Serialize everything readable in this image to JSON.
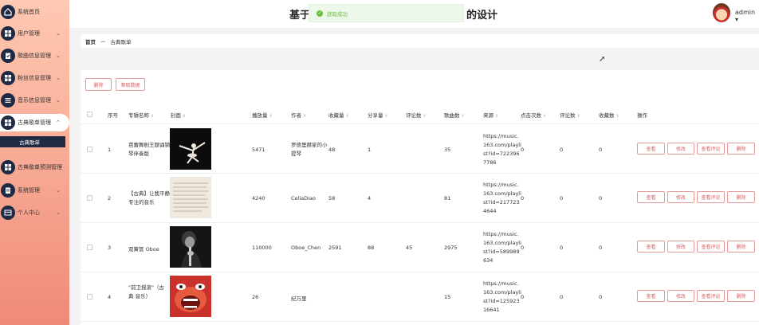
{
  "sidebar": {
    "items": [
      {
        "label": "系统首页",
        "icon": "home-icon"
      },
      {
        "label": "用户管理",
        "icon": "grid-icon",
        "arrow": "⌄"
      },
      {
        "label": "歌曲信息管理",
        "icon": "clipboard-icon",
        "arrow": "⌄"
      },
      {
        "label": "粉丝信息管理",
        "icon": "grid-icon",
        "arrow": "⌄"
      },
      {
        "label": "音乐信息管理",
        "icon": "list-icon",
        "arrow": "⌄"
      },
      {
        "label": "古典歌单管理",
        "icon": "grid-icon",
        "arrow": "⌃"
      },
      {
        "label": "古典歌单预测管理",
        "icon": "grid-icon"
      },
      {
        "label": "系统管理",
        "icon": "doc-icon",
        "arrow": "⌄"
      },
      {
        "label": "个人中心",
        "icon": "card-icon",
        "arrow": "⌄"
      }
    ],
    "sub_item": "古典歌单"
  },
  "header": {
    "title_left": "基于",
    "title_right": "的设计",
    "toast": "获取成功",
    "user": "admin ▾"
  },
  "breadcrumb": {
    "home": "首页",
    "sep": "—",
    "current": "古典歌单"
  },
  "toolbar": {
    "delete_label": "删除",
    "fetch_label": "爬取数据"
  },
  "table": {
    "headers": {
      "index": "序号",
      "album": "专辑名称",
      "cover": "封面",
      "plays": "播放量",
      "author": "作者",
      "collects": "收藏量",
      "shares": "分享量",
      "comments": "评论数",
      "songs": "歌曲数",
      "source": "来源",
      "clicks": "点击次数",
      "review_count": "评论数",
      "store_count": "收藏数",
      "ops": "操作"
    },
    "sort_glyph": "⇕",
    "rows": [
      {
        "index": "1",
        "album": "芭蕾舞剧王题诵钢琴伴奏版",
        "plays": "5471",
        "author": "罗德里赫家的小提琴",
        "collects": "48",
        "shares": "1",
        "comments": "",
        "songs": "35",
        "source": "https://music.163.com/playlist?id=7223967786",
        "clicks": "0",
        "review_count": "0",
        "store_count": "0"
      },
      {
        "index": "2",
        "album": "【古典】让我平静专注的音乐",
        "plays": "4240",
        "author": "CeliaDiao",
        "collects": "58",
        "shares": "4",
        "comments": "",
        "songs": "81",
        "source": "https://music.163.com/playlist?id=2177234644",
        "clicks": "0",
        "review_count": "0",
        "store_count": "0"
      },
      {
        "index": "3",
        "album": "双簧管 Oboe",
        "plays": "110000",
        "author": "Oboe_Chen",
        "collects": "2591",
        "shares": "88",
        "comments": "45",
        "songs": "2975",
        "source": "https://music.163.com/playlist?id=589989634",
        "clicks": "0",
        "review_count": "0",
        "store_count": "0"
      },
      {
        "index": "4",
        "album": "\"前卫摇滚\"（古典 音乐）",
        "plays": "26",
        "author": "纪万里",
        "collects": "",
        "shares": "",
        "comments": "",
        "songs": "15",
        "source": "https://music.163.com/playlist?id=12592316641",
        "clicks": "0",
        "review_count": "0",
        "store_count": "0"
      }
    ],
    "actions": {
      "view": "查看",
      "edit": "修改",
      "view_comments": "查看评论",
      "delete": "删除"
    }
  }
}
